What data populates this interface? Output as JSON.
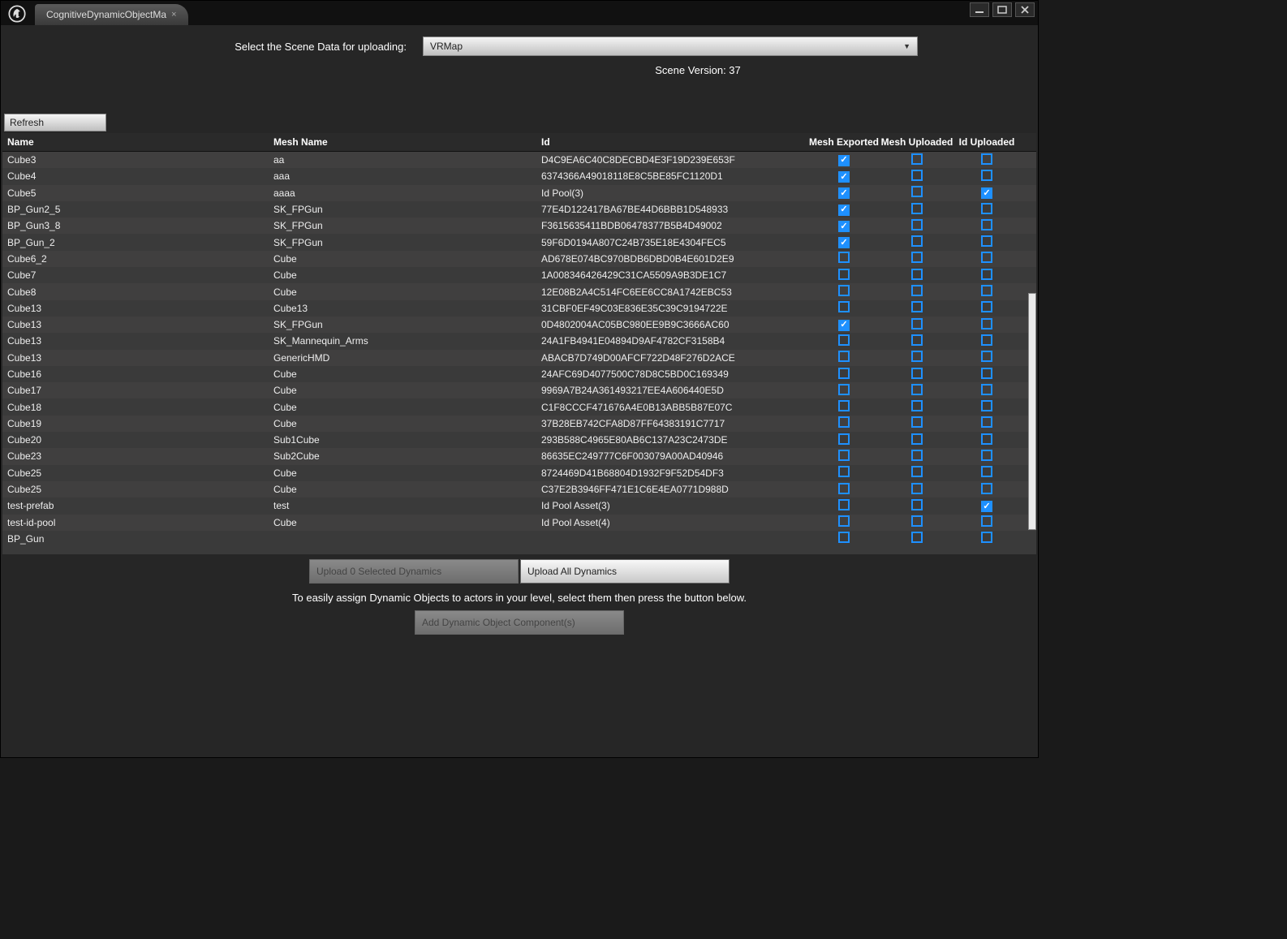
{
  "window": {
    "tab_title": "CognitiveDynamicObjectMa",
    "minimize": "–",
    "maximize": "□",
    "close": "✕"
  },
  "header": {
    "select_label": "Select the Scene Data for uploading:",
    "scene_selected": "VRMap",
    "scene_version_label": "Scene Version: 37",
    "refresh_label": "Refresh"
  },
  "columns": {
    "name": "Name",
    "mesh": "Mesh Name",
    "id": "Id",
    "exported": "Mesh Exported",
    "uploaded": "Mesh Uploaded",
    "id_uploaded": "Id Uploaded"
  },
  "rows": [
    {
      "name": "Cube3",
      "mesh": "aa",
      "id": "D4C9EA6C40C8DECBD4E3F19D239E653F",
      "exp": true,
      "upl": false,
      "idu": false
    },
    {
      "name": "Cube4",
      "mesh": "aaa",
      "id": "6374366A49018118E8C5BE85FC1120D1",
      "exp": true,
      "upl": false,
      "idu": false
    },
    {
      "name": "Cube5",
      "mesh": "aaaa",
      "id": "Id Pool(3)",
      "exp": true,
      "upl": false,
      "idu": true
    },
    {
      "name": "BP_Gun2_5",
      "mesh": "SK_FPGun",
      "id": "77E4D122417BA67BE44D6BBB1D548933",
      "exp": true,
      "upl": false,
      "idu": false
    },
    {
      "name": "BP_Gun3_8",
      "mesh": "SK_FPGun",
      "id": "F3615635411BDB06478377B5B4D49002",
      "exp": true,
      "upl": false,
      "idu": false
    },
    {
      "name": "BP_Gun_2",
      "mesh": "SK_FPGun",
      "id": "59F6D0194A807C24B735E18E4304FEC5",
      "exp": true,
      "upl": false,
      "idu": false
    },
    {
      "name": "Cube6_2",
      "mesh": "Cube",
      "id": "AD678E074BC970BDB6DBD0B4E601D2E9",
      "exp": false,
      "upl": false,
      "idu": false
    },
    {
      "name": "Cube7",
      "mesh": "Cube",
      "id": "1A008346426429C31CA5509A9B3DE1C7",
      "exp": false,
      "upl": false,
      "idu": false
    },
    {
      "name": "Cube8",
      "mesh": "Cube",
      "id": "12E08B2A4C514FC6EE6CC8A1742EBC53",
      "exp": false,
      "upl": false,
      "idu": false
    },
    {
      "name": "Cube13",
      "mesh": "Cube13",
      "id": "31CBF0EF49C03E836E35C39C9194722E",
      "exp": false,
      "upl": false,
      "idu": false
    },
    {
      "name": "Cube13",
      "mesh": "SK_FPGun",
      "id": "0D4802004AC05BC980EE9B9C3666AC60",
      "exp": true,
      "upl": false,
      "idu": false
    },
    {
      "name": "Cube13",
      "mesh": "SK_Mannequin_Arms",
      "id": "24A1FB4941E04894D9AF4782CF3158B4",
      "exp": false,
      "upl": false,
      "idu": false
    },
    {
      "name": "Cube13",
      "mesh": "GenericHMD",
      "id": "ABACB7D749D00AFCF722D48F276D2ACE",
      "exp": false,
      "upl": false,
      "idu": false
    },
    {
      "name": "Cube16",
      "mesh": "Cube",
      "id": "24AFC69D4077500C78D8C5BD0C169349",
      "exp": false,
      "upl": false,
      "idu": false
    },
    {
      "name": "Cube17",
      "mesh": "Cube",
      "id": "9969A7B24A361493217EE4A606440E5D",
      "exp": false,
      "upl": false,
      "idu": false
    },
    {
      "name": "Cube18",
      "mesh": "Cube",
      "id": "C1F8CCCF471676A4E0B13ABB5B87E07C",
      "exp": false,
      "upl": false,
      "idu": false
    },
    {
      "name": "Cube19",
      "mesh": "Cube",
      "id": "37B28EB742CFA8D87FF64383191C7717",
      "exp": false,
      "upl": false,
      "idu": false
    },
    {
      "name": "Cube20",
      "mesh": "Sub1Cube",
      "id": "293B588C4965E80AB6C137A23C2473DE",
      "exp": false,
      "upl": false,
      "idu": false
    },
    {
      "name": "Cube23",
      "mesh": "Sub2Cube",
      "id": "86635EC249777C6F003079A00AD40946",
      "exp": false,
      "upl": false,
      "idu": false
    },
    {
      "name": "Cube25",
      "mesh": "Cube",
      "id": "8724469D41B68804D1932F9F52D54DF3",
      "exp": false,
      "upl": false,
      "idu": false
    },
    {
      "name": "Cube25",
      "mesh": "Cube",
      "id": "C37E2B3946FF471E1C6E4EA0771D988D",
      "exp": false,
      "upl": false,
      "idu": false
    },
    {
      "name": "test-prefab",
      "mesh": "test",
      "id": "Id Pool Asset(3)",
      "exp": false,
      "upl": false,
      "idu": true
    },
    {
      "name": "test-id-pool",
      "mesh": "Cube",
      "id": "Id Pool Asset(4)",
      "exp": false,
      "upl": false,
      "idu": false
    },
    {
      "name": "BP_Gun",
      "mesh": "",
      "id": "",
      "exp": false,
      "upl": false,
      "idu": false
    }
  ],
  "bottom": {
    "upload_selected": "Upload 0 Selected Dynamics",
    "upload_all": "Upload All Dynamics",
    "help_text": "To easily assign Dynamic Objects to actors in your level, select them then press the button below.",
    "add_component": "Add Dynamic Object Component(s)"
  }
}
